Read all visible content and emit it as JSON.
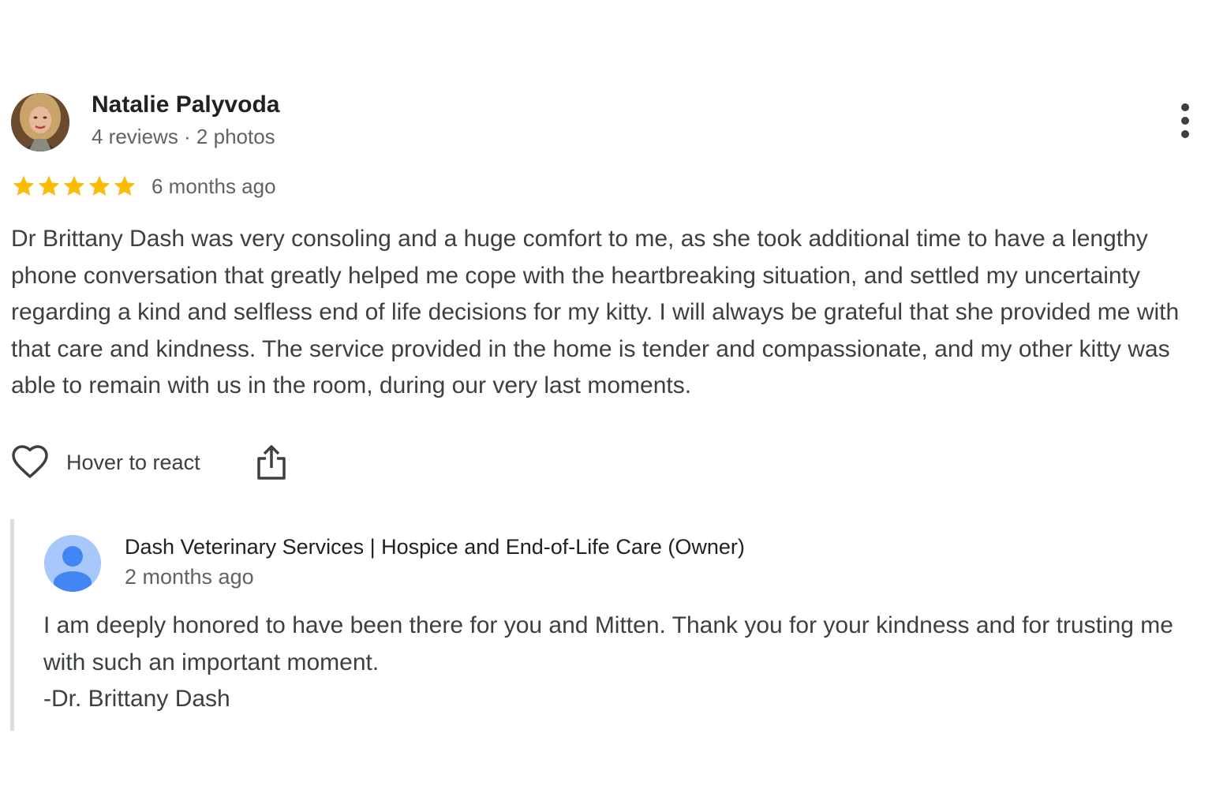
{
  "review": {
    "reviewer_name": "Natalie Palyvoda",
    "reviewer_meta": "4 reviews · 2 photos",
    "rating": 5,
    "rating_max": 5,
    "time_ago": "6 months ago",
    "text": "Dr Brittany Dash was very consoling and a huge comfort to me, as she took additional time to have a lengthy phone conversation that greatly helped me cope with the heartbreaking situation, and settled my uncertainty regarding a kind and selfless end of life decisions for my kitty. I will always be grateful that she provided me with that care and kindness. The service provided in the home is tender and compassionate, and my other kitty was able to remain with us in the room, during our very last moments.",
    "react_label": "Hover to react",
    "star_color": "#fbbc04"
  },
  "owner_reply": {
    "name": "Dash Veterinary Services | Hospice and End-of-Life Care (Owner)",
    "time_ago": "2 months ago",
    "lines": [
      "I am deeply honored to have been there for you and Mitten. Thank you for your kindness and for trusting me with such an important moment.",
      "-Dr. Brittany Dash"
    ],
    "avatar_bg": "#a8c7fa",
    "avatar_fg": "#4285f4"
  },
  "icons": {
    "more": "more-vert-icon",
    "heart": "heart-outline-icon",
    "share": "share-icon",
    "star": "star-icon",
    "person": "person-icon"
  }
}
